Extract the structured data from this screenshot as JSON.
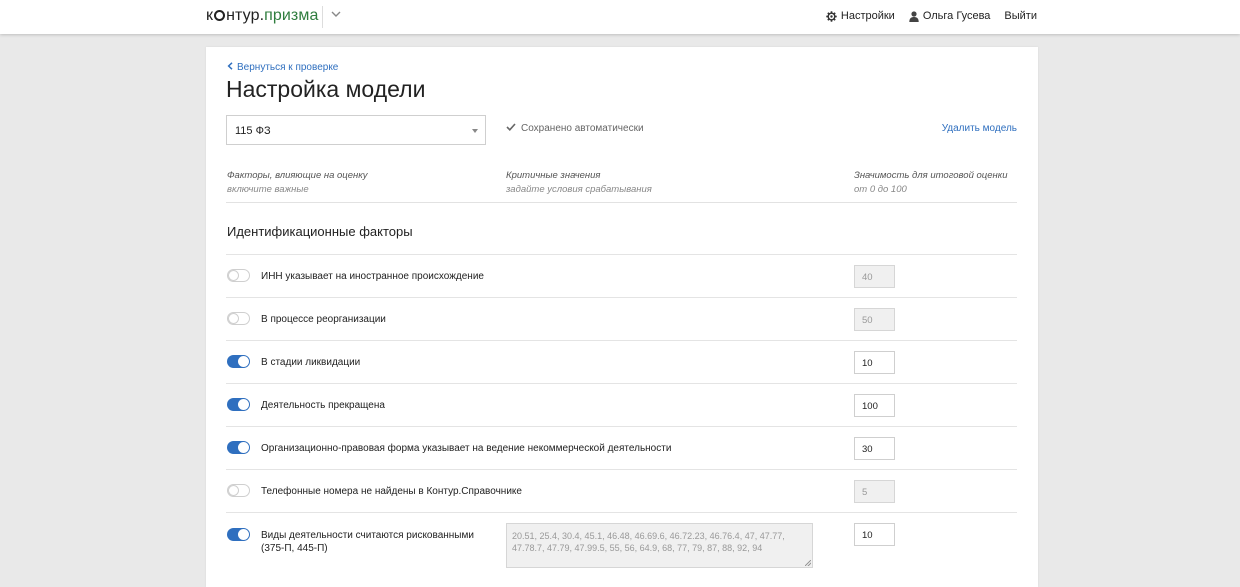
{
  "header": {
    "logo_brand_start": "к",
    "logo_brand_end": "нтур",
    "logo_dot": ".",
    "logo_product": "призма",
    "settings_label": "Настройки",
    "user_name": "Ольга Гусева",
    "logout_label": "Выйти"
  },
  "page": {
    "back_label": "Вернуться к проверке",
    "title": "Настройка модели",
    "model_select_value": "115 ФЗ",
    "saved_status": "Сохранено автоматически",
    "delete_label": "Удалить модель"
  },
  "columns": [
    {
      "title": "Факторы, влияющие на оценку",
      "hint": "включите важные"
    },
    {
      "title": "Критичные значения",
      "hint": "задайте условия срабатывания"
    },
    {
      "title": "Значимость для итоговой оценки",
      "hint": "от 0 до 100"
    }
  ],
  "section": {
    "title": "Идентификационные факторы",
    "factors": [
      {
        "label": "ИНН указывает на иностранное происхождение",
        "enabled": false,
        "weight": "40"
      },
      {
        "label": "В процессе реорганизации",
        "enabled": false,
        "weight": "50"
      },
      {
        "label": "В стадии ликвидации",
        "enabled": true,
        "weight": "10"
      },
      {
        "label": "Деятельность прекращена",
        "enabled": true,
        "weight": "100"
      },
      {
        "label": "Организационно-правовая форма указывает на ведение некоммерческой деятельности",
        "enabled": true,
        "weight": "30"
      },
      {
        "label": "Телефонные номера не найдены в Контур.Справочнике",
        "enabled": false,
        "weight": "5"
      },
      {
        "label": "Виды деятельности считаются рискованными (375-П, 445-П)",
        "enabled": true,
        "weight": "10",
        "critical_values": "20.51, 25.4, 30.4, 45.1, 46.48, 46.69.6, 46.72.23, 46.76.4, 47, 47.77, 47.78.7, 47.79, 47.99.5, 55, 56, 64.9, 68, 77, 79, 87, 88, 92, 94"
      }
    ]
  },
  "colors": {
    "accent": "#2f6fbf",
    "brand_green": "#2f7d3e",
    "background": "#e9e9e9"
  },
  "icons": [
    "gear-icon",
    "user-icon",
    "chevron-down-icon",
    "chevron-left-icon",
    "checkmark-icon"
  ]
}
